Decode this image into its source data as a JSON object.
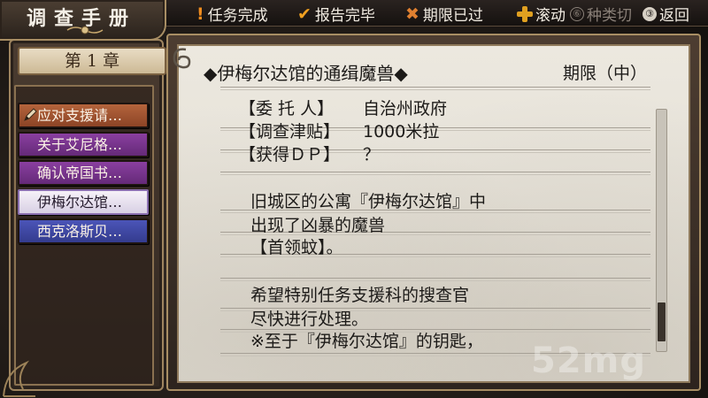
{
  "notebook_title": "调查手册",
  "legend": {
    "task_done": {
      "mark": "!",
      "label": "任务完成"
    },
    "report_done": {
      "mark": "✔",
      "label": "报告完毕"
    },
    "expired": {
      "mark": "✖",
      "label": "期限已过"
    },
    "scroll": {
      "label": "滚动"
    },
    "switch": {
      "key": "⑥",
      "label": "种类切"
    },
    "back": {
      "key": "③",
      "label": "返回"
    }
  },
  "colors": {
    "task_done": "#f08c1e",
    "report_done": "#f0a020",
    "expired": "#e08030"
  },
  "chapter": "第 1 章",
  "quests": [
    {
      "label": "应对支援请…",
      "color": "orange"
    },
    {
      "label": "关于艾尼格…",
      "color": "purple"
    },
    {
      "label": "确认帝国书…",
      "color": "purple"
    },
    {
      "label": "伊梅尔达馆…",
      "color": "selected"
    },
    {
      "label": "西克洛斯贝…",
      "color": "blue"
    }
  ],
  "detail": {
    "title": "◆伊梅尔达馆的通缉魔兽◆",
    "deadline": "期限（中）",
    "info": [
      {
        "key": "【委 托 人】",
        "value": "自治州政府"
      },
      {
        "key": "【调查津贴】",
        "value": "1000米拉"
      },
      {
        "key": "【获得ＤＰ】",
        "value": "？"
      }
    ],
    "body": [
      "旧城区的公寓『伊梅尔达馆』中",
      "出现了凶暴的魔兽",
      "【首领蚊】。",
      "希望特别任务支援科的搜查官",
      "尽快进行处理。",
      "※至于『伊梅尔达馆』的钥匙，"
    ]
  },
  "scroll_position": 0.95,
  "watermark": "52mg"
}
